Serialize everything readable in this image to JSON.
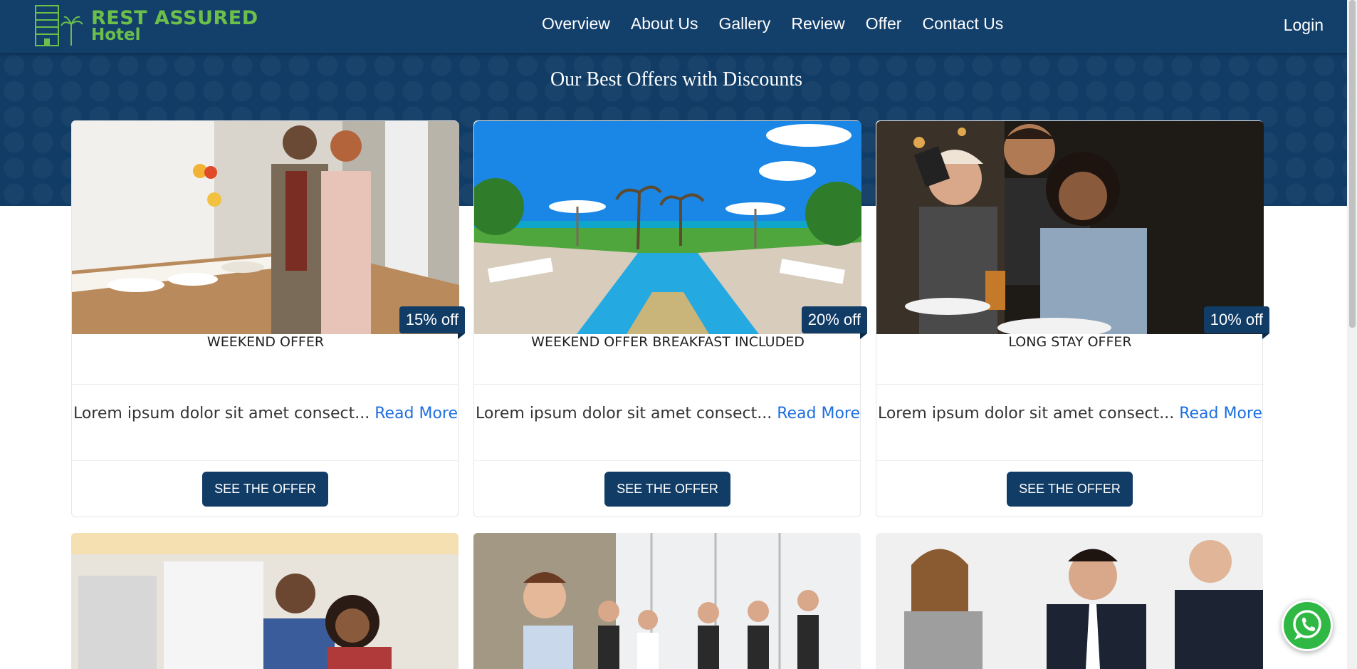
{
  "brand": {
    "line1": "REST ASSURED",
    "line2": "Hotel",
    "color": "#6cc04a"
  },
  "nav": {
    "items": [
      {
        "label": "Overview"
      },
      {
        "label": "About Us"
      },
      {
        "label": "Gallery"
      },
      {
        "label": "Review"
      },
      {
        "label": "Offer"
      },
      {
        "label": "Contact Us"
      }
    ],
    "login": "Login"
  },
  "section": {
    "title": "Our Best Offers with Discounts"
  },
  "offers": [
    {
      "title": "WEEKEND OFFER",
      "discount": "15% off",
      "description": "Lorem ipsum dolor sit amet consect...",
      "read_more": "Read More",
      "button": "SEE THE OFFER"
    },
    {
      "title": "WEEKEND OFFER BREAKFAST INCLUDED",
      "discount": "20% off",
      "description": "Lorem ipsum dolor sit amet consect...",
      "read_more": "Read More",
      "button": "SEE THE OFFER"
    },
    {
      "title": "LONG STAY OFFER",
      "discount": "10% off",
      "description": "Lorem ipsum dolor sit amet consect...",
      "read_more": "Read More",
      "button": "SEE THE OFFER"
    }
  ],
  "colors": {
    "primary": "#113c66",
    "link": "#1e6fe0",
    "whatsapp": "#2fb843"
  }
}
